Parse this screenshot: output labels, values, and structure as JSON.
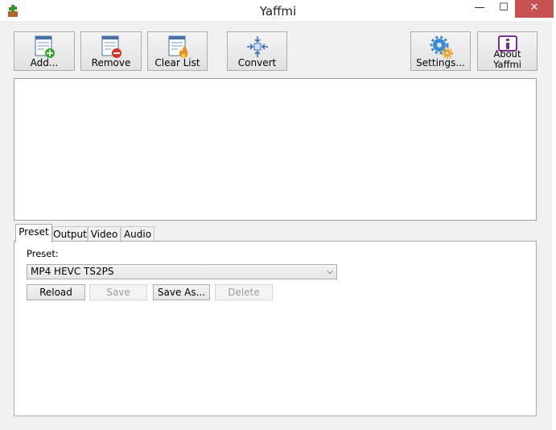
{
  "window": {
    "title": "Yaffmi",
    "minimize_glyph": "—",
    "maximize_glyph": "☐",
    "close_glyph": "✕"
  },
  "toolbar": {
    "add_label": "Add...",
    "remove_label": "Remove",
    "clear_label": "Clear List",
    "convert_label": "Convert",
    "settings_label": "Settings...",
    "about_line1": "About",
    "about_line2": "Yaffmi"
  },
  "file_list": {
    "items": []
  },
  "tabs": [
    {
      "label": "Preset"
    },
    {
      "label": "Output"
    },
    {
      "label": "Video"
    },
    {
      "label": "Audio"
    }
  ],
  "preset_panel": {
    "label": "Preset:",
    "selected": "MP4 HEVC TS2PS",
    "reload_label": "Reload",
    "save_label": "Save",
    "save_as_label": "Save As...",
    "delete_label": "Delete"
  },
  "icons": {
    "add": "list-add-icon",
    "remove": "list-remove-icon",
    "clear": "list-clear-flame-icon",
    "convert": "convert-arrows-icon",
    "settings": "gears-icon",
    "about": "info-icon"
  },
  "colors": {
    "close_button": "#c75050",
    "add_badge": "#2ea82e",
    "remove_badge": "#d9342b",
    "flame": "#f08a1c",
    "settings_gear": "#3a8ad6",
    "about_icon": "#7b2f8f"
  }
}
